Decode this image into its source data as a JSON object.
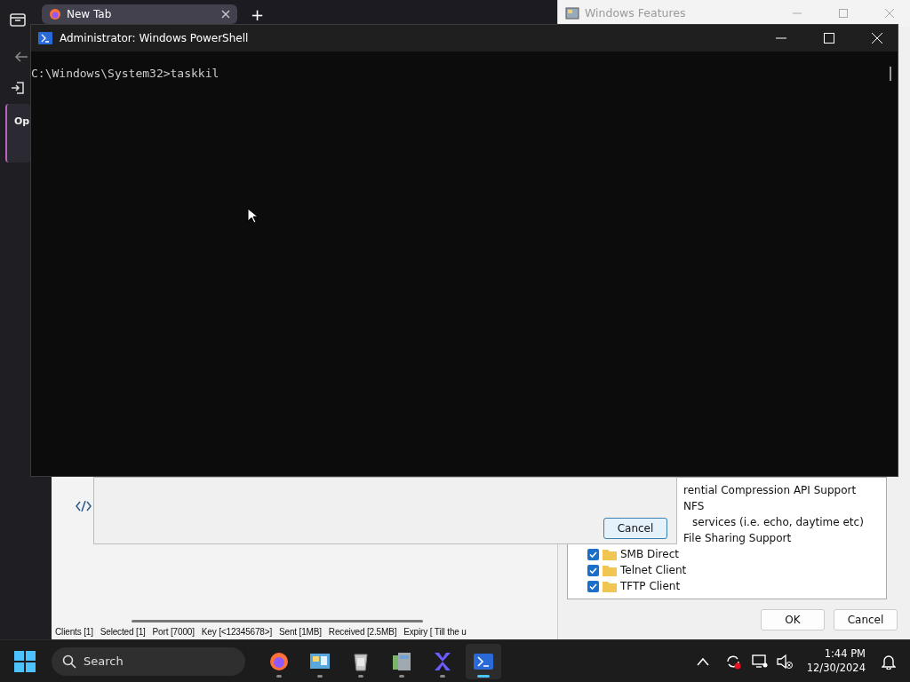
{
  "browser": {
    "tab": {
      "title": "New Tab"
    },
    "new_tab": "+",
    "side_label": "Op"
  },
  "background_app": {
    "status_bar": "Clients [1]   Selected [1]   Port [7000]   Key [<12345678>]   Sent [1MB]   Received [2.5MB]   Expiry [ Till the u"
  },
  "dialog": {
    "buttons": [
      "Cancel"
    ]
  },
  "windows_features": {
    "title": "Windows Features",
    "cut_labels": [
      "rential Compression API Support",
      "NFS",
      "services (i.e. echo, daytime etc)",
      "File Sharing Support"
    ],
    "items": [
      {
        "label": "SMB Direct",
        "checked": true
      },
      {
        "label": "Telnet Client",
        "checked": true
      },
      {
        "label": "TFTP Client",
        "checked": true
      }
    ],
    "buttons": [
      "OK",
      "Cancel"
    ]
  },
  "powershell": {
    "title": "Administrator: Windows PowerShell",
    "lines": [
      "C:\\Windows\\System32>taskkil"
    ]
  },
  "taskbar": {
    "search": "Search",
    "apps": [
      {
        "kind": "firefox",
        "selected": false
      },
      {
        "kind": "control",
        "selected": false
      },
      {
        "kind": "recycle",
        "selected": false
      },
      {
        "kind": "features",
        "selected": false
      },
      {
        "kind": "x",
        "selected": false
      },
      {
        "kind": "powershell",
        "selected": true
      }
    ],
    "time": "1:44 PM",
    "date": "12/30/2024"
  }
}
